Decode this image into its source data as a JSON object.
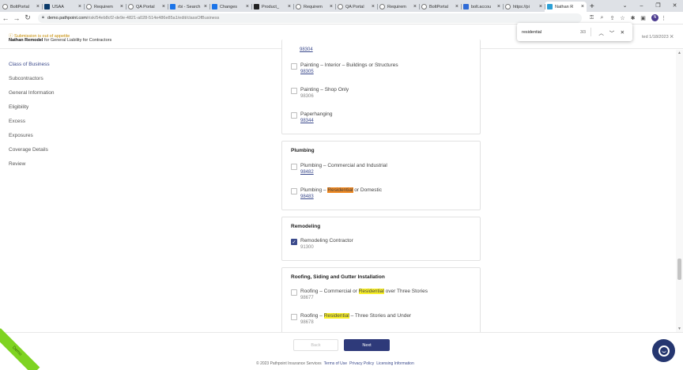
{
  "browser": {
    "tabs": [
      {
        "label": "BoltPortal",
        "icon": "globe-icon",
        "fav": "globe"
      },
      {
        "label": "USAA",
        "icon": "usaa-icon",
        "fav": "usaa"
      },
      {
        "label": "Requirem",
        "icon": "globe-icon",
        "fav": "globe"
      },
      {
        "label": "QA Portal",
        "icon": "globe-icon",
        "fav": "globe"
      },
      {
        "label": "rbi - Search",
        "icon": "app-icon",
        "fav": "sq"
      },
      {
        "label": "Changes",
        "icon": "app-icon",
        "fav": "sq"
      },
      {
        "label": "Product_",
        "icon": "doc-icon",
        "fav": "blk"
      },
      {
        "label": "Requirem",
        "icon": "globe-icon",
        "fav": "globe"
      },
      {
        "label": "QA Portal",
        "icon": "globe-icon",
        "fav": "globe"
      },
      {
        "label": "Requirem",
        "icon": "globe-icon",
        "fav": "globe"
      },
      {
        "label": "BoltPortal",
        "icon": "globe-icon",
        "fav": "globe"
      },
      {
        "label": "bolt.accou",
        "icon": "bolt-icon",
        "fav": "bolt"
      },
      {
        "label": "https://pi",
        "icon": "page-icon",
        "fav": "globe"
      },
      {
        "label": "Nathan R",
        "icon": "pathpoint-icon",
        "fav": "path",
        "active": true
      }
    ],
    "url_host": "demo.pathpoint.com",
    "url_path": "/risk/54eb8cf2-de9e-4821-a028-514e486e85a1/edit/classOfBusiness",
    "profile_initial": "N"
  },
  "find": {
    "query": "residential",
    "count": "3/3"
  },
  "header": {
    "appetite_warning": "Submission is out of appetite",
    "applicant_name": "Nathan Remodel",
    "subtitle_suffix": "for General Liability for Contractors",
    "saved_text": "ted 1/18/2023"
  },
  "nav": [
    {
      "label": "Class of Business",
      "active": true
    },
    {
      "label": "Subcontractors"
    },
    {
      "label": "General Information"
    },
    {
      "label": "Eligibility"
    },
    {
      "label": "Excess"
    },
    {
      "label": "Exposures"
    },
    {
      "label": "Coverage Details"
    },
    {
      "label": "Review"
    }
  ],
  "painting": {
    "partial_code": "98304",
    "items": [
      {
        "label": "Painting – Interior – Buildings or Structures",
        "code": "98305"
      },
      {
        "label": "Painting – Shop Only",
        "code": "98306"
      },
      {
        "label": "Paperhanging",
        "code": "98344"
      }
    ]
  },
  "plumbing": {
    "title": "Plumbing",
    "items": [
      {
        "label": "Plumbing – Commercial and Industrial",
        "code": "98482"
      },
      {
        "pre": "Plumbing – ",
        "hl": "Residential",
        "post": " or Domestic",
        "code": "98483"
      }
    ]
  },
  "remodeling": {
    "title": "Remodeling",
    "items": [
      {
        "label": "Remodeling Contractor",
        "code": "91300",
        "checked": true
      }
    ]
  },
  "roofing": {
    "title": "Roofing, Siding and Gutter Installation",
    "items": [
      {
        "pre": "Roofing – Commercial or ",
        "hl": "Residential",
        "post": " over Three Stories",
        "code": "98677"
      },
      {
        "pre": "Roofing – ",
        "hl": "Residential",
        "post": " – Three Stories and Under",
        "code": "98678"
      }
    ]
  },
  "footer": {
    "back": "Back",
    "next": "Next",
    "copyright": "© 2023 Pathpoint Insurance Services",
    "links": [
      "Terms of Use",
      "Privacy Policy",
      "Licensing Information"
    ]
  },
  "ribbon": "Demo",
  "colors": {
    "accent": "#2e3a7a",
    "warning": "#c48a00",
    "find_highlight": "#f8ef2a",
    "find_current": "#f08a24",
    "ribbon": "#7ed321"
  }
}
